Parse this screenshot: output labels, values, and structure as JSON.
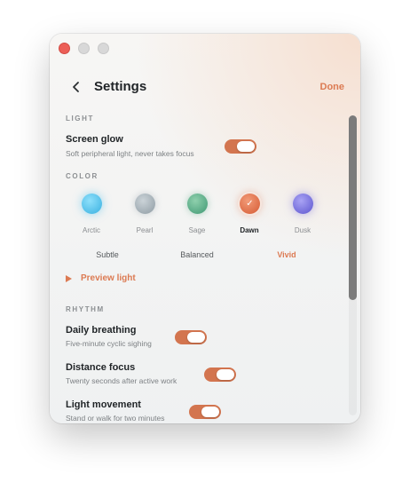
{
  "header": {
    "title": "Settings",
    "done_label": "Done"
  },
  "light": {
    "section_label": "LIGHT",
    "screen_glow": {
      "title": "Screen glow",
      "subtitle": "Soft peripheral light, never takes focus",
      "enabled": true
    }
  },
  "color": {
    "section_label": "COLOR",
    "swatches": [
      {
        "label": "Arctic",
        "color": "#5bc4ea",
        "selected": false
      },
      {
        "label": "Pearl",
        "color": "#a9b4bb",
        "selected": false
      },
      {
        "label": "Sage",
        "color": "#5fae8a",
        "selected": false
      },
      {
        "label": "Dawn",
        "color": "#e0724a",
        "selected": true
      },
      {
        "label": "Dusk",
        "color": "#7a74de",
        "selected": false
      }
    ],
    "intensity": [
      {
        "label": "Subtle",
        "active": false
      },
      {
        "label": "Balanced",
        "active": false
      },
      {
        "label": "Vivid",
        "active": true
      }
    ],
    "preview_label": "Preview light"
  },
  "rhythm": {
    "section_label": "RHYTHM",
    "items": [
      {
        "title": "Daily breathing",
        "subtitle": "Five-minute cyclic sighing",
        "enabled": true
      },
      {
        "title": "Distance focus",
        "subtitle": "Twenty seconds after active work",
        "enabled": true
      },
      {
        "title": "Light movement",
        "subtitle": "Stand or walk for two minutes",
        "enabled": true
      }
    ]
  },
  "accent_color": "#dc7a52"
}
